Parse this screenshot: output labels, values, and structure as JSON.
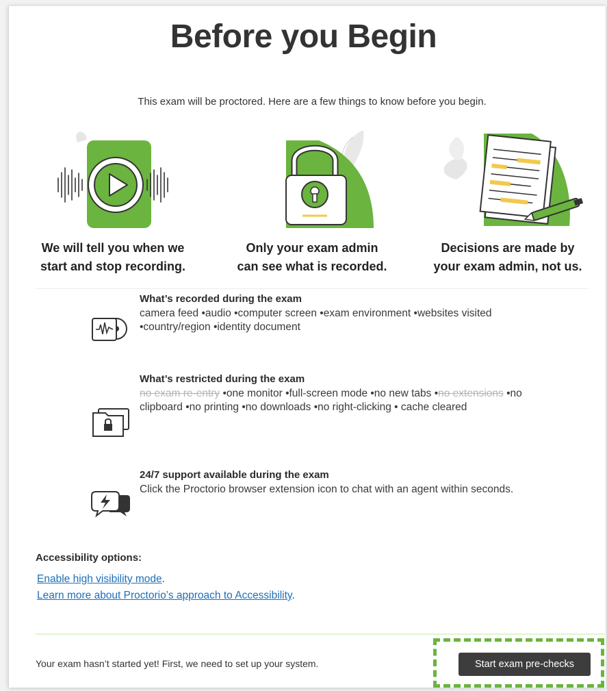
{
  "page": {
    "title": "Before you Begin",
    "intro": "This exam will be proctored. Here are a few things to know before you begin."
  },
  "features": [
    {
      "icon": "play-recording-icon",
      "line1": "We will tell you when we",
      "line2": "start and stop recording."
    },
    {
      "icon": "padlock-icon",
      "line1": "Only your exam admin",
      "line2": "can see what is recorded."
    },
    {
      "icon": "document-pen-icon",
      "line1": "Decisions are made by",
      "line2": "your exam admin, not us."
    }
  ],
  "info": {
    "recorded": {
      "heading": "What’s recorded during the exam",
      "body": "camera feed •audio •computer screen •exam environment •websites visited •country/region •identity document"
    },
    "restricted": {
      "heading": "What’s restricted during the exam",
      "struck1": "no exam re-entry",
      "mid1": " •one monitor •full-screen mode •no new tabs •",
      "struck2": "no extensions",
      "mid2": " •no clipboard •no printing •no downloads •no right-clicking • cache cleared"
    },
    "support": {
      "heading": "24/7 support available during the exam",
      "body": "Click the Proctorio browser extension icon to chat with an agent within seconds."
    }
  },
  "accessibility": {
    "heading": "Accessibility options:",
    "link1": "Enable high visibility mode",
    "link2": "Learn more about Proctorio’s approach to Accessibility",
    "period": "."
  },
  "footer": {
    "message": "Your exam hasn’t started yet! First, we need to set up your system.",
    "button": "Start exam pre-checks"
  },
  "colors": {
    "brand_green": "#6bb43f",
    "button_dark": "#3d3d3d",
    "link_blue": "#1d6fb8",
    "highlight_yellow": "#f2c94c"
  }
}
